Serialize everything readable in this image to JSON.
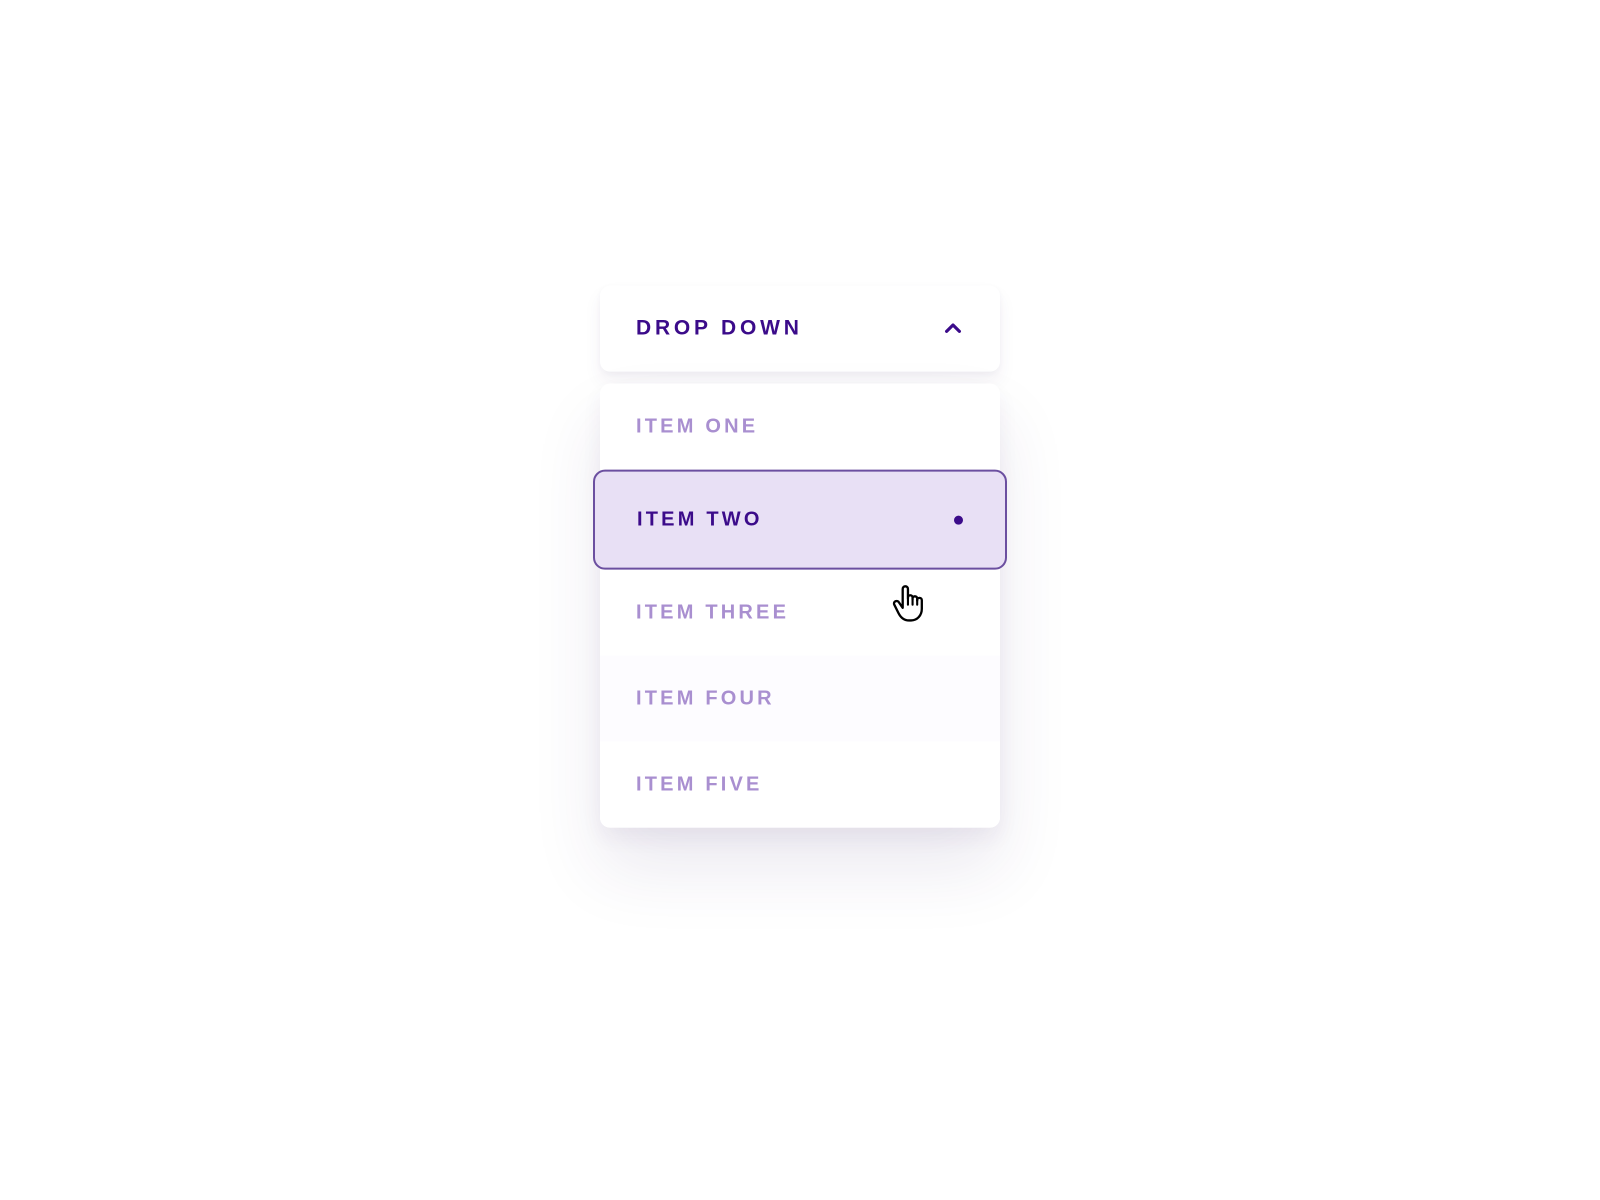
{
  "colors": {
    "purple_dark": "#3b0b8a",
    "purple_light": "#a98fd0",
    "hover_bg": "#e8e0f5",
    "hover_border": "#6b4fa0"
  },
  "dropdown": {
    "label": "Drop Down",
    "expanded": true,
    "hovered_index": 1,
    "items": [
      {
        "label": "Item One"
      },
      {
        "label": "Item Two"
      },
      {
        "label": "Item Three"
      },
      {
        "label": "Item Four"
      },
      {
        "label": "Item Five"
      }
    ]
  }
}
